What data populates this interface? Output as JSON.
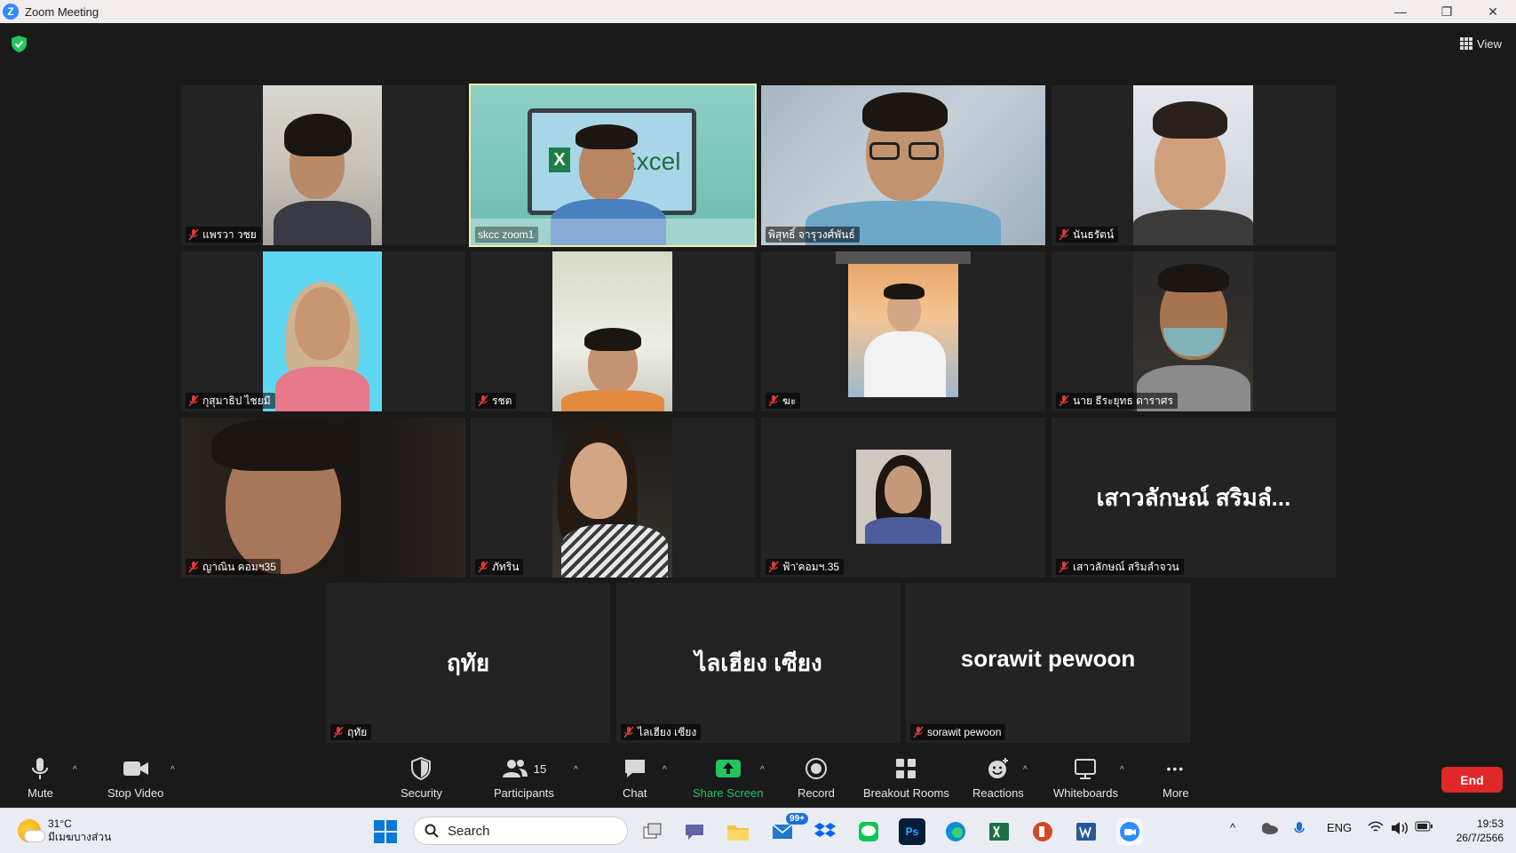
{
  "window": {
    "title": "Zoom Meeting",
    "app_letter": "Z",
    "minimize": "—",
    "restore": "❐",
    "close": "✕"
  },
  "meeting": {
    "view_label": "View",
    "tiles": [
      {
        "label": "แพรวา วชย",
        "muted": true
      },
      {
        "label": "skcc zoom1",
        "muted": false,
        "slide_text": "Excel",
        "slide_letter": "X"
      },
      {
        "label": "พิสุทธิ์ จารุวงศ์พันธ์",
        "muted": false
      },
      {
        "label": "นันธรัตน์",
        "muted": true
      },
      {
        "label": "กุสุมาธิป ไชยมี",
        "muted": true
      },
      {
        "label": "รชต",
        "muted": true
      },
      {
        "label": "ฆะ",
        "muted": true
      },
      {
        "label": "นาย ธีระยุทธ ดาราศร",
        "muted": true
      },
      {
        "label": "ญาณิน คอมฯ35",
        "muted": true
      },
      {
        "label": "ภัทริน",
        "muted": true
      },
      {
        "label": "ฟ้า'คอมฯ.35",
        "muted": true
      },
      {
        "label": "เสาวลักษณ์ สริมลำจวน",
        "muted": true,
        "display_name": "เสาวลักษณ์ สริมลํ..."
      },
      {
        "label": "ฤทัย",
        "muted": true,
        "display_name": "ฤทัย"
      },
      {
        "label": "ไลเฮียง เซียง",
        "muted": true,
        "display_name": "ไลเฮียง เซียง"
      },
      {
        "label": "sorawit pewoon",
        "muted": true,
        "display_name": "sorawit pewoon"
      }
    ]
  },
  "toolbar": {
    "mute": "Mute",
    "stop_video": "Stop Video",
    "security": "Security",
    "participants": "Participants",
    "participants_count": "15",
    "chat": "Chat",
    "share_screen": "Share Screen",
    "record": "Record",
    "breakout_rooms": "Breakout Rooms",
    "reactions": "Reactions",
    "whiteboards": "Whiteboards",
    "more": "More",
    "end": "End",
    "caret": "^",
    "more_dots": "•••"
  },
  "taskbar": {
    "weather_temp": "31°C",
    "weather_desc": "มีเมฆบางส่วน",
    "search_placeholder": "Search",
    "mail_badge": "99+",
    "ps_label": "Ps",
    "language": "ENG",
    "time": "19:53",
    "date": "26/7/2566",
    "chevron": "^"
  },
  "colors": {
    "accent_active_speaker": "#f0eea6",
    "share_green": "#22c55e",
    "end_red": "#e02828",
    "mute_red": "#e03a3a"
  }
}
